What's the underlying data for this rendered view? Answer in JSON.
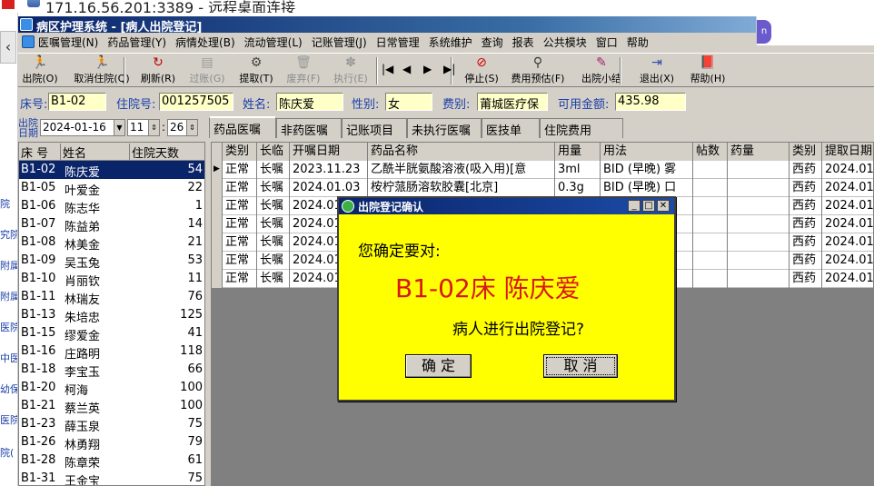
{
  "remote_desktop": {
    "title": "171.16.56.201:3389 - 远程桌面连接"
  },
  "left_strip": {
    "items": [
      "院",
      "究院",
      "附属",
      "附属",
      "医院",
      "中医",
      "幼保",
      "医院",
      "院("
    ]
  },
  "window": {
    "title": "病区护理系统 - [病人出院登记]"
  },
  "menu": [
    "医嘱管理(N)",
    "药品管理(Y)",
    "病情处理(B)",
    "流动管理(L)",
    "记账管理(J)",
    "日常管理",
    "系统维护",
    "查询",
    "报表",
    "公共模块",
    "窗口",
    "帮助"
  ],
  "toolbar": {
    "buttons": [
      {
        "label": "出院(O)",
        "icon": "run-person-icon",
        "enabled": true
      },
      {
        "label": "取消住院(Q)",
        "icon": "run-person-icon",
        "enabled": true
      },
      {
        "label": "刷新(R)",
        "icon": "refresh-icon",
        "enabled": true
      },
      {
        "label": "过账(G)",
        "icon": "post-icon",
        "enabled": false
      },
      {
        "label": "提取(T)",
        "icon": "extract-icon",
        "enabled": true
      },
      {
        "label": "废弃(F)",
        "icon": "discard-icon",
        "enabled": false
      },
      {
        "label": "执行(E)",
        "icon": "execute-icon",
        "enabled": false
      },
      {
        "label": "停止(S)",
        "icon": "stop-icon",
        "enabled": true
      },
      {
        "label": "费用预估(F)",
        "icon": "estimate-icon",
        "enabled": true
      },
      {
        "label": "出院小结",
        "icon": "summary-pen-icon",
        "enabled": true
      },
      {
        "label": "退出(X)",
        "icon": "exit-icon",
        "enabled": true
      },
      {
        "label": "帮助(H)",
        "icon": "help-book-icon",
        "enabled": true
      }
    ],
    "nav": [
      "|◀",
      "◀",
      "▶",
      "▶|"
    ]
  },
  "patient": {
    "bed_label": "床号:",
    "bed": "B1-02",
    "admission_label": "住院号:",
    "admission_no": "001257505",
    "name_label": "姓名:",
    "name": "陈庆爱",
    "gender_label": "性别:",
    "gender": "女",
    "fee_label": "费别:",
    "fee_type": "莆城医疗保",
    "balance_label": "可用金额:",
    "balance": "435.98"
  },
  "date_filter": {
    "label_top": "出院",
    "label_bottom": "日期",
    "date": "2024-01-16",
    "hour": "11",
    "minute": "26"
  },
  "patient_list": {
    "headers": [
      "床 号",
      "姓名",
      "住院天数"
    ],
    "rows": [
      [
        "B1-02",
        "陈庆爱",
        "54"
      ],
      [
        "B1-05",
        "叶爱金",
        "22"
      ],
      [
        "B1-06",
        "陈志华",
        "1"
      ],
      [
        "B1-07",
        "陈益弟",
        "14"
      ],
      [
        "B1-08",
        "林美金",
        "21"
      ],
      [
        "B1-09",
        "吴玉兔",
        "53"
      ],
      [
        "B1-10",
        "肖丽钦",
        "11"
      ],
      [
        "B1-11",
        "林瑞友",
        "76"
      ],
      [
        "B1-13",
        "朱培忠",
        "125"
      ],
      [
        "B1-15",
        "缪爱金",
        "41"
      ],
      [
        "B1-16",
        "庄路明",
        "118"
      ],
      [
        "B1-18",
        "李宝玉",
        "66"
      ],
      [
        "B1-20",
        "柯海",
        "100"
      ],
      [
        "B1-21",
        "蔡兰英",
        "100"
      ],
      [
        "B1-23",
        "薛玉泉",
        "75"
      ],
      [
        "B1-26",
        "林勇翔",
        "79"
      ],
      [
        "B1-28",
        "陈章荣",
        "61"
      ],
      [
        "B1-31",
        "王金宝",
        "75"
      ]
    ]
  },
  "tabs": [
    "药品医嘱",
    "非药医嘱",
    "记账项目",
    "未执行医嘱",
    "医技单",
    "住院费用"
  ],
  "orders": {
    "headers": [
      "类别",
      "长临",
      "开嘱日期",
      "药品名称",
      "用量",
      "用法",
      "帖数",
      "药量",
      "类别",
      "提取日期"
    ],
    "rows": [
      [
        "正常",
        "长嘱",
        "2023.11.23",
        "乙酰半胱氨酸溶液(吸入用)[意",
        "3ml",
        "BID (早晚) 雾",
        "",
        "",
        "西药",
        "2024.01"
      ],
      [
        "正常",
        "长嘱",
        "2024.01.03",
        "桉柠蒎肠溶软胶囊[北京]",
        "0.3g",
        "BID (早晚) 口",
        "",
        "",
        "西药",
        "2024.01"
      ],
      [
        "正常",
        "长嘱",
        "2024.01",
        "",
        "",
        "",
        "",
        "",
        "西药",
        "2024.01"
      ],
      [
        "正常",
        "长嘱",
        "2024.01",
        "",
        "",
        "",
        "",
        "",
        "西药",
        "2024.01"
      ],
      [
        "正常",
        "长嘱",
        "2024.01",
        "",
        "",
        "",
        "",
        "",
        "西药",
        "2024.01"
      ],
      [
        "正常",
        "长嘱",
        "2024.01",
        "",
        "",
        "",
        "",
        "",
        "西药",
        "2024.01"
      ],
      [
        "正常",
        "长嘱",
        "2024.01",
        "",
        "",
        "",
        "",
        "",
        "西药",
        "2024.01"
      ]
    ]
  },
  "dialog": {
    "title": "出院登记确认",
    "line1": "您确定要对:",
    "line2": "B1-02床 陈庆爱",
    "line3": "病人进行出院登记?",
    "ok": "确 定",
    "cancel": "取 消"
  },
  "colors": {
    "dialog_bg": "#ffff00",
    "highlight_red": "#d81818",
    "title_blue": "#0a246a",
    "field_yellow": "#ffffc8",
    "label_blue": "#1a3ea8"
  }
}
